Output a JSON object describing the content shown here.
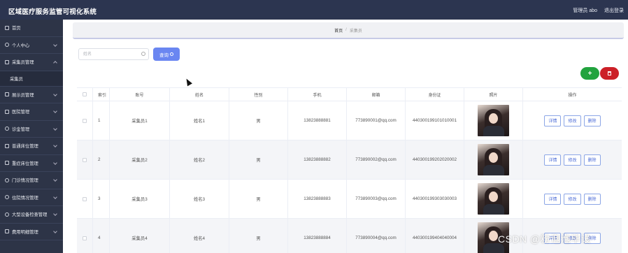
{
  "app": {
    "title": "区域医疗服务监管可视化系统",
    "user": "管理员 abo",
    "logout": "退出登录"
  },
  "sidebar": {
    "items": [
      {
        "label": "首页"
      },
      {
        "label": "个人中心"
      },
      {
        "label": "采集员管理"
      },
      {
        "label": "采集员"
      },
      {
        "label": "展示员管理"
      },
      {
        "label": "医院管理"
      },
      {
        "label": "诊金管理"
      },
      {
        "label": "普通床位管理"
      },
      {
        "label": "重症床位管理"
      },
      {
        "label": "门诊情况管理"
      },
      {
        "label": "住院情况管理"
      },
      {
        "label": "大型设备检查管理"
      },
      {
        "label": "费用明细管理"
      }
    ]
  },
  "breadcrumb": {
    "home": "首页",
    "sep": "/",
    "current": "采集员"
  },
  "search": {
    "placeholder": "姓名",
    "button_label": "查询"
  },
  "actions": {
    "add_label": "+"
  },
  "table": {
    "headers": [
      "索引",
      "账号",
      "姓名",
      "性别",
      "手机",
      "邮箱",
      "身份证",
      "照片",
      "操作"
    ],
    "rows": [
      {
        "index": "1",
        "account": "采集员1",
        "name": "姓名1",
        "gender": "男",
        "phone": "13823888881",
        "email": "773890001@qq.com",
        "idcard": "440300199101010001"
      },
      {
        "index": "2",
        "account": "采集员2",
        "name": "姓名2",
        "gender": "男",
        "phone": "13823888882",
        "email": "773890002@qq.com",
        "idcard": "440300199202020002"
      },
      {
        "index": "3",
        "account": "采集员3",
        "name": "姓名3",
        "gender": "男",
        "phone": "13823888883",
        "email": "773890003@qq.com",
        "idcard": "440300199303030003"
      },
      {
        "index": "4",
        "account": "采集员4",
        "name": "姓名4",
        "gender": "男",
        "phone": "13823888884",
        "email": "773890004@qq.com",
        "idcard": "440300199404040004"
      }
    ],
    "row_actions": {
      "detail": "详情",
      "edit": "修改",
      "delete": "删除"
    }
  },
  "watermark": "CSDN @粉泡泡毕设"
}
